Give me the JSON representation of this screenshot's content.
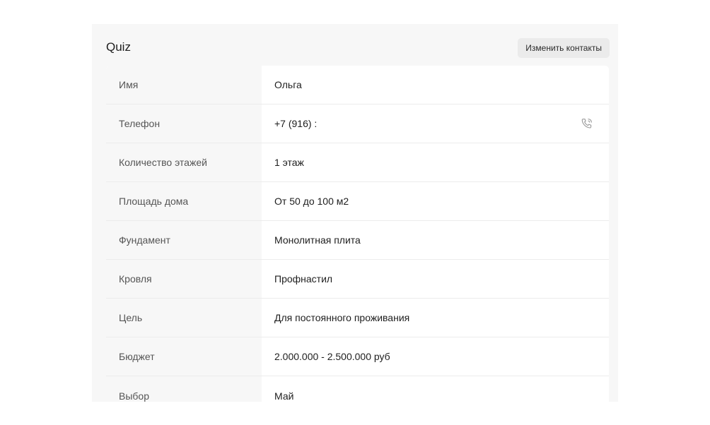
{
  "header": {
    "title": "Quiz",
    "edit_contacts_label": "Изменить контакты"
  },
  "rows": [
    {
      "label": "Имя",
      "value": "Ольга"
    },
    {
      "label": "Телефон",
      "value": "+7 (916) :",
      "icon": "phone-call-icon"
    },
    {
      "label": "Количество этажей",
      "value": "1 этаж"
    },
    {
      "label": "Площадь дома",
      "value": "От 50 до 100 м2"
    },
    {
      "label": "Фундамент",
      "value": "Монолитная плита"
    },
    {
      "label": "Кровля",
      "value": "Профнастил"
    },
    {
      "label": "Цель",
      "value": "Для постоянного проживания"
    },
    {
      "label": "Бюджет",
      "value": "2.000.000 - 2.500.000 руб"
    },
    {
      "label": "Выбор",
      "value": "Май"
    }
  ],
  "colors": {
    "panel_background": "#f7f7f7",
    "card_background": "#ffffff",
    "button_background": "#ebebeb",
    "icon_color": "#9a9a9a"
  }
}
